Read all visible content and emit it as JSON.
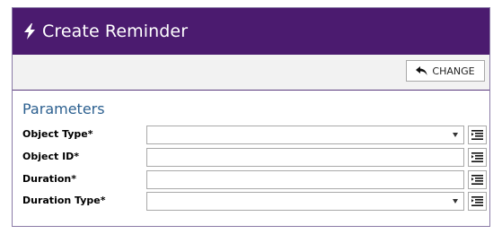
{
  "dialog": {
    "title": "Create Reminder",
    "title_icon": "lightning-bolt-icon",
    "header_color": "#4b1b6f"
  },
  "toolbar": {
    "change_label": "CHANGE",
    "change_icon": "undo-arrow-icon"
  },
  "parameters": {
    "heading": "Parameters",
    "fields": [
      {
        "label": "Object Type*",
        "type": "select",
        "value": ""
      },
      {
        "label": "Object ID*",
        "type": "text",
        "value": ""
      },
      {
        "label": "Duration*",
        "type": "text",
        "value": ""
      },
      {
        "label": "Duration Type*",
        "type": "select",
        "value": ""
      }
    ],
    "side_button_icon": "list-picker-icon"
  }
}
